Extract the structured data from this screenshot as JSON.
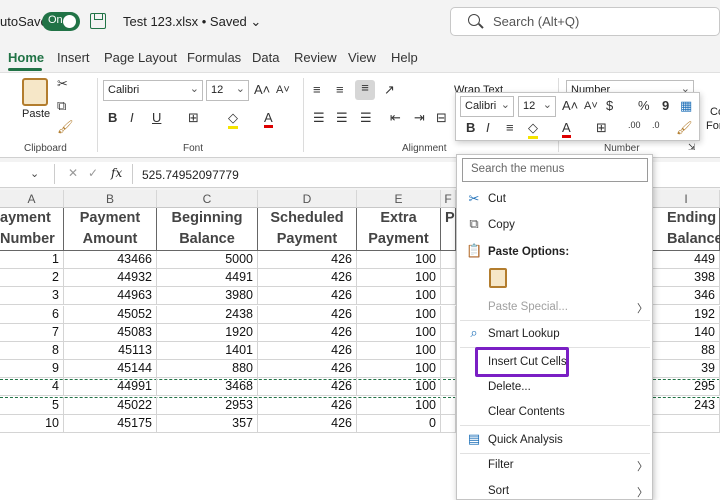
{
  "titlebar": {
    "autosave_label": "utoSave",
    "toggle_text": "On",
    "file_title": "Test 123.xlsx • Saved ⌄",
    "search_placeholder": "Search (Alt+Q)"
  },
  "tabs": [
    "Home",
    "Insert",
    "Page Layout",
    "Formulas",
    "Data",
    "Review",
    "View",
    "Help"
  ],
  "ribbon": {
    "clipboard_label": "Clipboard",
    "paste_label": "Paste",
    "font_label": "Font",
    "font_name": "Calibri",
    "font_size": "12",
    "alignment_label": "Alignment",
    "wrap_text": "Wrap Text",
    "number_label": "Number",
    "number_format": "Number",
    "cond_fmt_partial": "Co",
    "format_partial": "For"
  },
  "mini_toolbar": {
    "font_name": "Calibri",
    "font_size": "12"
  },
  "formula_bar": {
    "namebox": "",
    "fx": "fx",
    "value": "525.74952097779"
  },
  "columns": [
    "A",
    "B",
    "C",
    "D",
    "E",
    "F",
    "I"
  ],
  "headers": {
    "A": [
      "ayment",
      "Number"
    ],
    "B": [
      "Payment",
      "Amount"
    ],
    "C": [
      "Beginning",
      "Balance"
    ],
    "D": [
      "Scheduled",
      "Payment"
    ],
    "E": [
      "Extra",
      "Payment"
    ],
    "F": [
      "",
      "P"
    ],
    "I": [
      "Ending",
      "Balance"
    ]
  },
  "rows": [
    [
      "1",
      "43466",
      "5000",
      "426",
      "100",
      "449"
    ],
    [
      "2",
      "44932",
      "4491",
      "426",
      "100",
      "398"
    ],
    [
      "3",
      "44963",
      "3980",
      "426",
      "100",
      "346"
    ],
    [
      "6",
      "45052",
      "2438",
      "426",
      "100",
      "192"
    ],
    [
      "7",
      "45083",
      "1920",
      "426",
      "100",
      "140"
    ],
    [
      "8",
      "45113",
      "1401",
      "426",
      "100",
      "88"
    ],
    [
      "9",
      "45144",
      "880",
      "426",
      "100",
      "39"
    ],
    [
      "4",
      "44991",
      "3468",
      "426",
      "100",
      "295"
    ],
    [
      "5",
      "45022",
      "2953",
      "426",
      "100",
      "243"
    ],
    [
      "10",
      "45175",
      "357",
      "426",
      "0",
      ""
    ]
  ],
  "context_menu": {
    "search_placeholder": "Search the menus",
    "items": {
      "cut": "Cut",
      "copy": "Copy",
      "paste_options": "Paste Options:",
      "paste_special": "Paste Special...",
      "smart_lookup": "Smart Lookup",
      "insert_cut_cells": "Insert Cut Cells",
      "delete": "Delete...",
      "clear_contents": "Clear Contents",
      "quick_analysis": "Quick Analysis",
      "filter": "Filter",
      "sort": "Sort"
    }
  },
  "colors": {
    "accent": "#217346",
    "highlight": "#7a1fc4"
  }
}
